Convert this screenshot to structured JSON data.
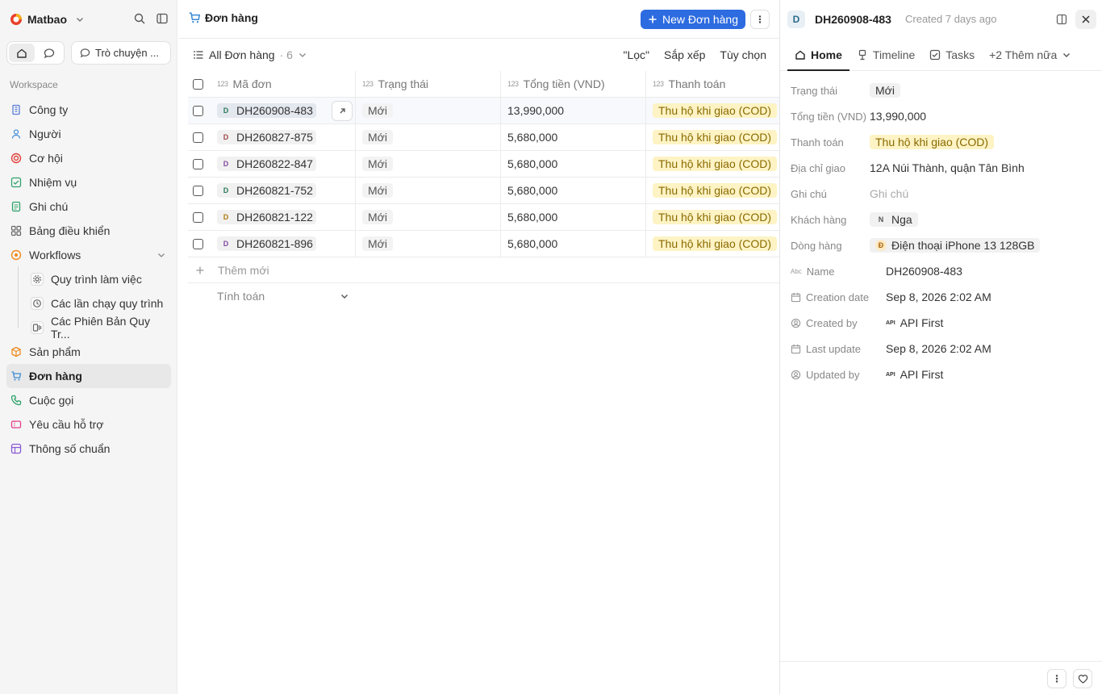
{
  "workspace": {
    "name": "Matbao",
    "chat_label": "Trò chuyện ...",
    "section_label": "Workspace"
  },
  "nav": [
    {
      "label": "Công ty",
      "icon": "building-icon",
      "color": "#5a7dd6"
    },
    {
      "label": "Người",
      "icon": "person-icon",
      "color": "#4a90d9"
    },
    {
      "label": "Cơ hội",
      "icon": "target-icon",
      "color": "#e0403a"
    },
    {
      "label": "Nhiệm vụ",
      "icon": "checkbox-icon",
      "color": "#2fa36b"
    },
    {
      "label": "Ghi chú",
      "icon": "note-icon",
      "color": "#2fa36b"
    },
    {
      "label": "Bảng điều khiển",
      "icon": "dashboard-icon",
      "color": "#666666"
    },
    {
      "label": "Workflows",
      "icon": "workflow-icon",
      "color": "#f08a1c"
    },
    {
      "label": "Quy trình làm việc",
      "icon": "settings-icon",
      "color": "#666666"
    },
    {
      "label": "Các lần chạy quy trình",
      "icon": "history-icon",
      "color": "#666666"
    },
    {
      "label": "Các Phiên Bản Quy Tr...",
      "icon": "versions-icon",
      "color": "#666666"
    },
    {
      "label": "Sản phẩm",
      "icon": "box-icon",
      "color": "#f08a1c"
    },
    {
      "label": "Đơn hàng",
      "icon": "cart-icon",
      "color": "#3a8ad6"
    },
    {
      "label": "Cuộc gọi",
      "icon": "phone-icon",
      "color": "#2fa36b"
    },
    {
      "label": "Yêu cầu hỗ trợ",
      "icon": "ticket-icon",
      "color": "#e0408a"
    },
    {
      "label": "Thông số chuẩn",
      "icon": "spec-icon",
      "color": "#8a5ad6"
    }
  ],
  "page": {
    "title": "Đơn hàng",
    "new_button": "New Đơn hàng"
  },
  "view": {
    "name": "All Đơn hàng",
    "count": "· 6",
    "filter": "\"Lọc\"",
    "sort": "Sắp xếp",
    "options": "Tùy chọn"
  },
  "table": {
    "columns": [
      "Mã đơn",
      "Trạng thái",
      "Tổng tiền (VND)",
      "Thanh toán"
    ],
    "rows": [
      {
        "avatar": "D",
        "avatar_color": "#2a7a5a",
        "id": "DH260908-483",
        "status": "Mới",
        "total": "13,990,000",
        "payment": "Thu hộ khi giao (COD)"
      },
      {
        "avatar": "D",
        "avatar_color": "#a04a4a",
        "id": "DH260827-875",
        "status": "Mới",
        "total": "5,680,000",
        "payment": "Thu hộ khi giao (COD)"
      },
      {
        "avatar": "D",
        "avatar_color": "#8a4aa0",
        "id": "DH260822-847",
        "status": "Mới",
        "total": "5,680,000",
        "payment": "Thu hộ khi giao (COD)"
      },
      {
        "avatar": "D",
        "avatar_color": "#2a7a5a",
        "id": "DH260821-752",
        "status": "Mới",
        "total": "5,680,000",
        "payment": "Thu hộ khi giao (COD)"
      },
      {
        "avatar": "D",
        "avatar_color": "#b07a10",
        "id": "DH260821-122",
        "status": "Mới",
        "total": "5,680,000",
        "payment": "Thu hộ khi giao (COD)"
      },
      {
        "avatar": "D",
        "avatar_color": "#8a4aa0",
        "id": "DH260821-896",
        "status": "Mới",
        "total": "5,680,000",
        "payment": "Thu hộ khi giao (COD)"
      }
    ],
    "add_new": "Thêm mới",
    "calc": "Tính toán"
  },
  "detail": {
    "avatar": "D",
    "title": "DH260908-483",
    "created": "Created 7 days ago",
    "tabs": [
      "Home",
      "Timeline",
      "Tasks",
      "+2 Thêm nữa"
    ],
    "fields": {
      "status_label": "Trạng thái",
      "status": "Mới",
      "total_label": "Tổng tiền (VND)",
      "total": "13,990,000",
      "payment_label": "Thanh toán",
      "payment": "Thu hộ khi giao (COD)",
      "address_label": "Địa chỉ giao",
      "address": "12A Núi Thành, quận Tân Bình",
      "note_label": "Ghi chú",
      "note_placeholder": "Ghi chú",
      "customer_label": "Khách hàng",
      "customer_initial": "N",
      "customer": "Nga",
      "line_label": "Dòng hàng",
      "line_initial": "Đ",
      "line": "Điện thoại iPhone 13 128GB"
    },
    "system": {
      "name_label": "Name",
      "name": "DH260908-483",
      "creation_label": "Creation date",
      "creation": "Sep 8, 2026 2:02 AM",
      "created_by_label": "Created by",
      "created_by": "API First",
      "last_update_label": "Last update",
      "last_update": "Sep 8, 2026 2:02 AM",
      "updated_by_label": "Updated by",
      "updated_by": "API First"
    }
  }
}
